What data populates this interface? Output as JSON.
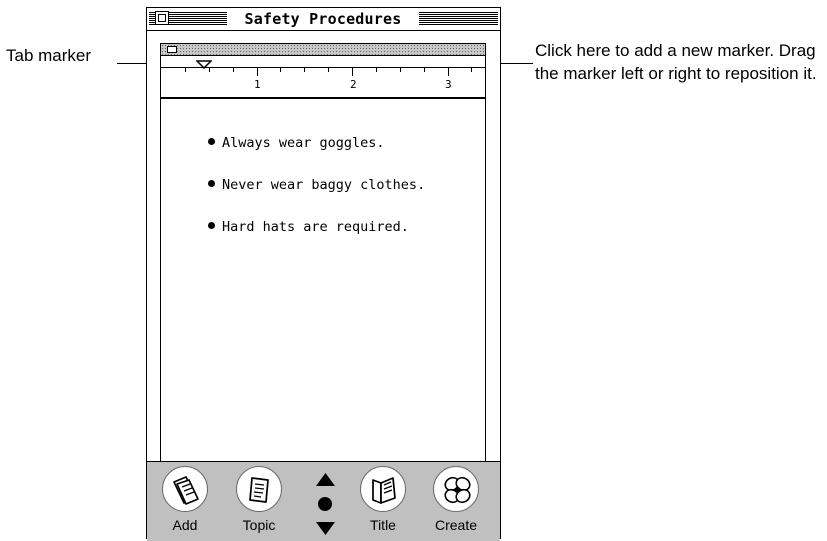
{
  "window": {
    "title": "Safety Procedures"
  },
  "callouts": {
    "tab_marker": "Tab marker",
    "add_marker": "Click here to add a new marker. Drag the marker left or right to reposition it."
  },
  "ruler": {
    "labels": [
      "1",
      "2",
      "3"
    ]
  },
  "content": {
    "items": [
      "Always wear goggles.",
      "Never wear baggy clothes.",
      "Hard hats are required."
    ]
  },
  "toolbar": {
    "add_label": "Add",
    "topic_label": "Topic",
    "title_label": "Title",
    "create_label": "Create"
  }
}
